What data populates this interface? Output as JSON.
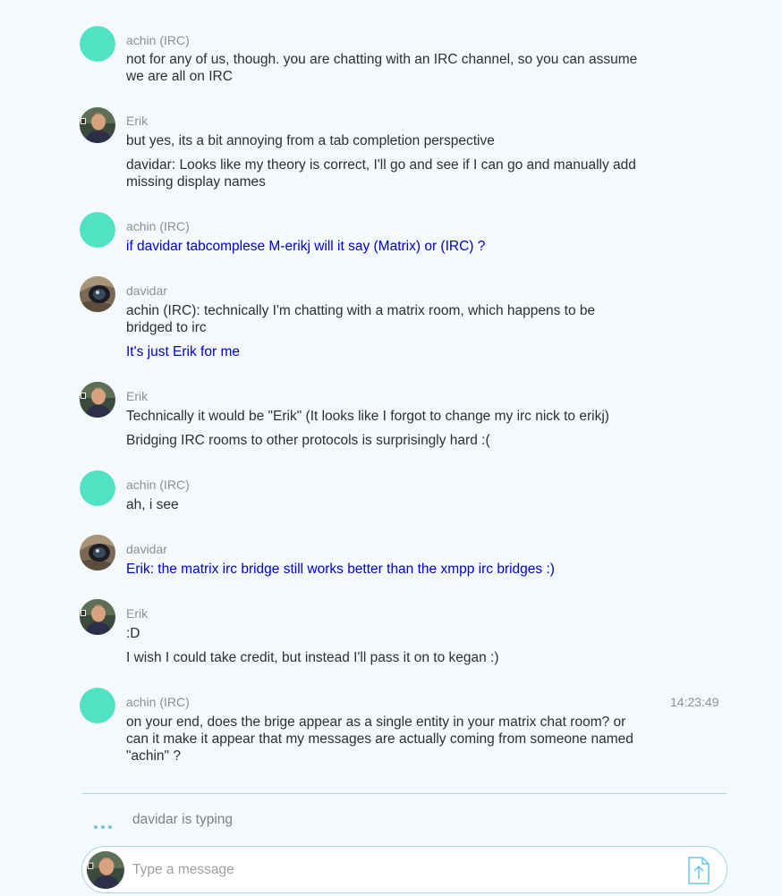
{
  "timeline": {
    "groups": [
      {
        "sender": "achin (IRC)",
        "avatar": "plain-teal",
        "timestamp": "",
        "messages": [
          {
            "text": "not for any of us, though. you are chatting with an IRC channel, so you can assume we are all on IRC",
            "highlight": false
          }
        ]
      },
      {
        "sender": "Erik",
        "avatar": "erik-photo",
        "timestamp": "",
        "messages": [
          {
            "text": "but yes, its a bit annoying from a tab completion perspective",
            "highlight": false
          },
          {
            "text": "davidar: Looks like my theory is correct, I'll go and see if I can go and manually add missing display names",
            "highlight": false
          }
        ]
      },
      {
        "sender": "achin (IRC)",
        "avatar": "plain-teal",
        "timestamp": "",
        "messages": [
          {
            "text": "if davidar tabcomplese M-erikj will it say (Matrix) or (IRC) ?",
            "highlight": true
          }
        ]
      },
      {
        "sender": "davidar",
        "avatar": "davidar-photo",
        "timestamp": "",
        "messages": [
          {
            "text": "achin (IRC): technically I'm chatting with a matrix room, which happens to be bridged to irc",
            "highlight": false
          },
          {
            "text": "It's just Erik for me",
            "highlight": true
          }
        ]
      },
      {
        "sender": "Erik",
        "avatar": "erik-photo",
        "timestamp": "",
        "messages": [
          {
            "text": "Technically it would be \"Erik\"  (It looks like I forgot to  change my irc nick to erikj)",
            "highlight": false
          },
          {
            "text": "Bridging IRC rooms to other protocols is surprisingly hard :(",
            "highlight": false
          }
        ]
      },
      {
        "sender": "achin (IRC)",
        "avatar": "plain-teal",
        "timestamp": "",
        "messages": [
          {
            "text": "ah, i see",
            "highlight": false
          }
        ]
      },
      {
        "sender": "davidar",
        "avatar": "davidar-photo",
        "timestamp": "",
        "messages": [
          {
            "text": "Erik: the matrix irc bridge still works better than the xmpp irc bridges :)",
            "highlight": true
          }
        ]
      },
      {
        "sender": "Erik",
        "avatar": "erik-photo",
        "timestamp": "",
        "messages": [
          {
            "text": ":D",
            "highlight": false
          },
          {
            "text": "I wish I could take credit, but instead I'll pass it on to kegan :)",
            "highlight": false
          }
        ]
      },
      {
        "sender": "achin (IRC)",
        "avatar": "plain-teal",
        "timestamp": "14:23:49",
        "messages": [
          {
            "text": "on your end, does the brige appear as a single entity in your matrix chat room?  or can it make it appear that my messages are actually coming from someone named \"achin\" ?",
            "highlight": false
          }
        ]
      }
    ]
  },
  "typing": {
    "text": "davidar is typing"
  },
  "composer": {
    "placeholder": "Type a message",
    "upload_icon": "upload-icon"
  },
  "colors": {
    "background": "#f4f9fc",
    "accent": "#76cfa6",
    "teal_avatar": "#50e2c2",
    "highlight_text": "#0000cc",
    "divider": "#a8d3ea"
  }
}
